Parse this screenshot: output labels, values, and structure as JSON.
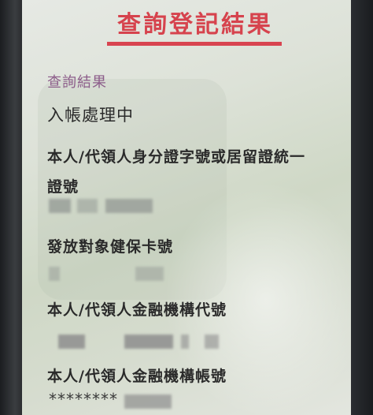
{
  "page": {
    "title": "查詢登記結果"
  },
  "result": {
    "label": "查詢結果",
    "status": "入帳處理中"
  },
  "fields": [
    {
      "label_line1": "本人/代領人身分證字號或居留證統一",
      "label_line2": "證號"
    },
    {
      "label": "發放對象健保卡號"
    },
    {
      "label": "本人/代領人金融機構代號"
    },
    {
      "label": "本人/代領人金融機構帳號",
      "masked_value": "********"
    }
  ],
  "colors": {
    "title": "#d6434d",
    "result_label": "#8c5d8a",
    "text": "#2a2a2a"
  }
}
